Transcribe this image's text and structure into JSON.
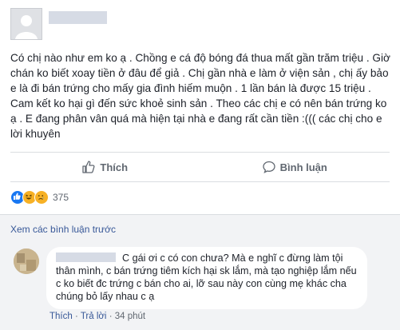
{
  "post": {
    "body": "Có chị nào như em ko ạ . Chồng e cá độ bóng đá thua mất gần trăm triệu . Giờ chán ko biết xoay tiền ở đâu để giả . Chị gần nhà e làm ở viện sản , chị ấy bảo e là đi bán trứng cho mấy gia đình hiếm muộn . 1 lần bán là được 15 triệu . Cam kết ko hại gì đến sức khoẻ sinh sản . Theo các chị e có nên bán trứng ko ạ . E đang phân vân quá mà hiện tại nhà e đang rất cần tiền :((( các chị cho e lời khuyên"
  },
  "actions": {
    "like_label": "Thích",
    "comment_label": "Bình luận"
  },
  "reactions": {
    "count": "375",
    "types": [
      "like-icon",
      "haha-icon",
      "sad-icon"
    ],
    "colors": {
      "like": "#1877f2",
      "haha": "#f7b125",
      "sad": "#f7b125"
    }
  },
  "comments": {
    "view_more_label": "Xem các bình luận trước",
    "items": [
      {
        "text": "C gái ơi c có con chưa? Mà e nghĩ c đừng làm tội thân mình, c bán trứng tiêm kích hại sk lắm, mà tạo nghiệp lắm nếu c ko biết đc trứng c bán cho ai, lỡ sau này con cùng mẹ khác cha chúng bỏ lấy nhau c ạ",
        "like_label": "Thích",
        "reply_label": "Trả lời",
        "time": "34 phút",
        "separator": "·"
      }
    ]
  },
  "theme": {
    "link_color": "#385898",
    "text_color": "#1d2129",
    "muted_color": "#606770"
  }
}
